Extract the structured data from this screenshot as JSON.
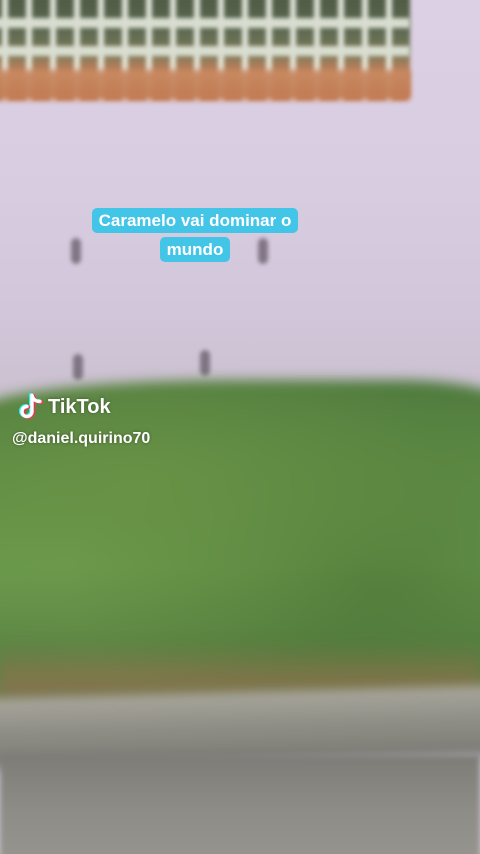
{
  "caption": {
    "line1": "Caramelo vai dominar o",
    "line2": "mundo"
  },
  "watermark": {
    "brand": "TikTok",
    "icon": "tiktok-logo-icon",
    "handle": "@daniel.quirino70"
  },
  "colors": {
    "caption_bg": "#43c5e8",
    "wall": "#dcd0e4",
    "grass": "#5d8a44"
  }
}
